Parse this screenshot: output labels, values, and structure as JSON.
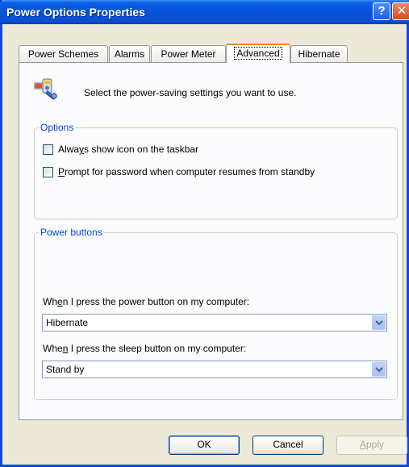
{
  "window": {
    "title": "Power Options Properties",
    "help_glyph": "?",
    "close_glyph": "✕"
  },
  "tabs": [
    {
      "label": "Power Schemes",
      "active": false
    },
    {
      "label": "Alarms",
      "active": false
    },
    {
      "label": "Power Meter",
      "active": false
    },
    {
      "label": "Advanced",
      "active": true
    },
    {
      "label": "Hibernate",
      "active": false
    }
  ],
  "advanced": {
    "icon": "power-settings-icon",
    "intro": "Select the power-saving settings you want to use.",
    "options": {
      "legend": "Options",
      "items": [
        {
          "pre": "Alwa",
          "ul": "y",
          "post": "s show icon on the taskbar",
          "checked": false
        },
        {
          "pre": "",
          "ul": "P",
          "post": "rompt for password when computer resumes from standby",
          "checked": false
        }
      ]
    },
    "power_buttons": {
      "legend": "Power buttons",
      "power_prompt": {
        "pre": "Wh",
        "ul": "e",
        "post": "n I press the power button on my computer:"
      },
      "power_value": "Hibernate",
      "sleep_prompt": {
        "pre": "Whe",
        "ul": "n",
        "post": " I press the sleep button on my computer:"
      },
      "sleep_value": "Stand by"
    }
  },
  "buttons": {
    "ok": "OK",
    "cancel": "Cancel",
    "apply": {
      "ul": "A",
      "post": "pply"
    }
  },
  "colors": {
    "titlebar": "#0653d8",
    "legend_text": "#0046d5",
    "active_tab_accent": "#e68b2c"
  }
}
